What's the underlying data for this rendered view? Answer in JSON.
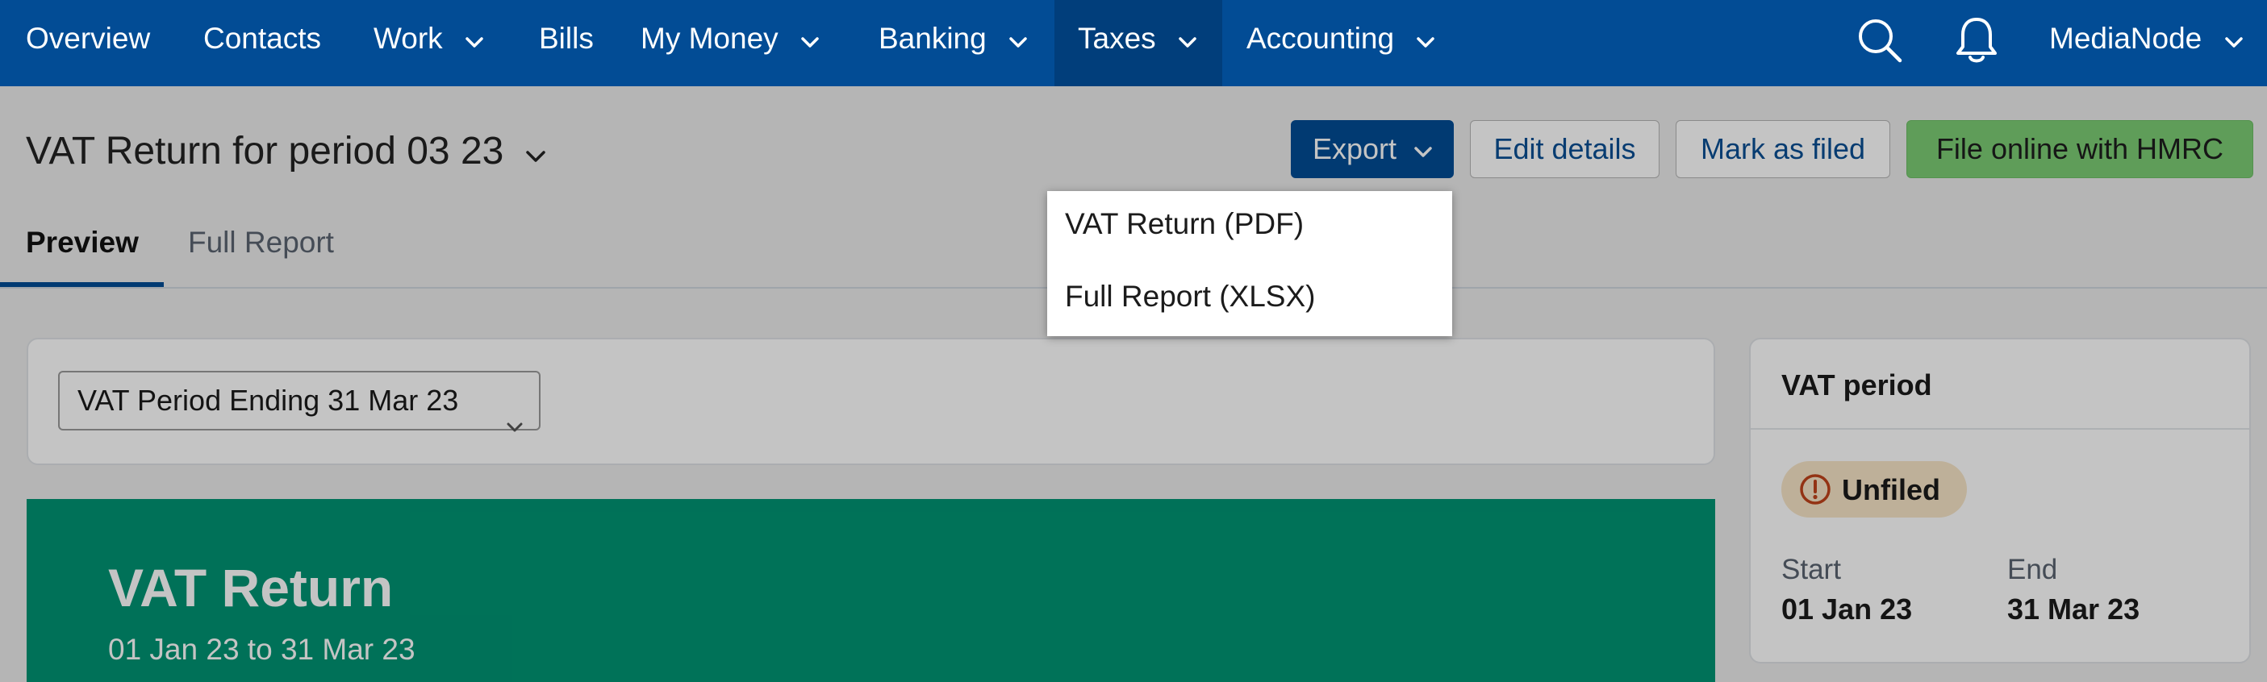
{
  "nav": {
    "items": [
      {
        "label": "Overview"
      },
      {
        "label": "Contacts"
      },
      {
        "label": "Work"
      },
      {
        "label": "Bills"
      },
      {
        "label": "My Money"
      },
      {
        "label": "Banking"
      },
      {
        "label": "Taxes"
      },
      {
        "label": "Accounting"
      }
    ],
    "active": "Taxes",
    "account_name": "MediaNode",
    "icons": [
      "search-icon",
      "bell-icon"
    ],
    "color": "#024c95"
  },
  "header": {
    "title": "VAT Return for period 03 23",
    "buttons": {
      "export": "Export",
      "edit": "Edit details",
      "mark_filed": "Mark as filed",
      "file_online": "File online with HMRC"
    }
  },
  "export_menu": {
    "items": [
      "VAT Return (PDF)",
      "Full Report (XLSX)"
    ]
  },
  "tabs": {
    "items": [
      "Preview",
      "Full Report"
    ],
    "active": "Preview"
  },
  "period_select": {
    "value": "VAT Period Ending 31 Mar 23"
  },
  "hero": {
    "title": "VAT Return",
    "subtitle": "01 Jan 23 to 31 Mar 23",
    "color": "#009473"
  },
  "sidebar": {
    "title": "VAT period",
    "status": "Unfiled",
    "start_label": "Start",
    "start_value": "01 Jan 23",
    "end_label": "End",
    "end_value": "31 Mar 23"
  }
}
